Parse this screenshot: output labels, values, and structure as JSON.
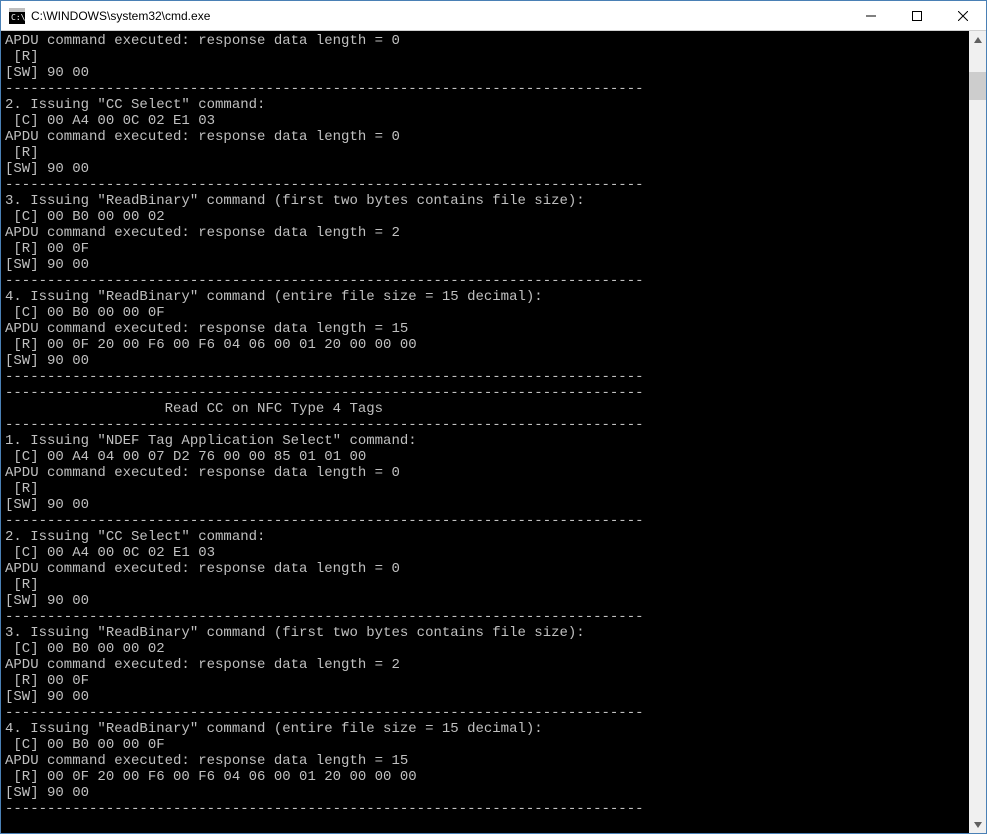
{
  "window": {
    "title": "C:\\WINDOWS\\system32\\cmd.exe"
  },
  "console_lines": [
    "APDU command executed: response data length = 0",
    " [R]",
    "[SW] 90 00",
    "----------------------------------------------------------------------------",
    "2. Issuing \"CC Select\" command:",
    " [C] 00 A4 00 0C 02 E1 03",
    "APDU command executed: response data length = 0",
    " [R]",
    "[SW] 90 00",
    "----------------------------------------------------------------------------",
    "3. Issuing \"ReadBinary\" command (first two bytes contains file size):",
    " [C] 00 B0 00 00 02",
    "APDU command executed: response data length = 2",
    " [R] 00 0F",
    "[SW] 90 00",
    "----------------------------------------------------------------------------",
    "4. Issuing \"ReadBinary\" command (entire file size = 15 decimal):",
    " [C] 00 B0 00 00 0F",
    "APDU command executed: response data length = 15",
    " [R] 00 0F 20 00 F6 00 F6 04 06 00 01 20 00 00 00",
    "[SW] 90 00",
    "----------------------------------------------------------------------------",
    "----------------------------------------------------------------------------",
    "                   Read CC on NFC Type 4 Tags",
    "----------------------------------------------------------------------------",
    "1. Issuing \"NDEF Tag Application Select\" command:",
    " [C] 00 A4 04 00 07 D2 76 00 00 85 01 01 00",
    "APDU command executed: response data length = 0",
    " [R]",
    "[SW] 90 00",
    "----------------------------------------------------------------------------",
    "2. Issuing \"CC Select\" command:",
    " [C] 00 A4 00 0C 02 E1 03",
    "APDU command executed: response data length = 0",
    " [R]",
    "[SW] 90 00",
    "----------------------------------------------------------------------------",
    "3. Issuing \"ReadBinary\" command (first two bytes contains file size):",
    " [C] 00 B0 00 00 02",
    "APDU command executed: response data length = 2",
    " [R] 00 0F",
    "[SW] 90 00",
    "----------------------------------------------------------------------------",
    "4. Issuing \"ReadBinary\" command (entire file size = 15 decimal):",
    " [C] 00 B0 00 00 0F",
    "APDU command executed: response data length = 15",
    " [R] 00 0F 20 00 F6 00 F6 04 06 00 01 20 00 00 00",
    "[SW] 90 00",
    "----------------------------------------------------------------------------",
    ""
  ]
}
